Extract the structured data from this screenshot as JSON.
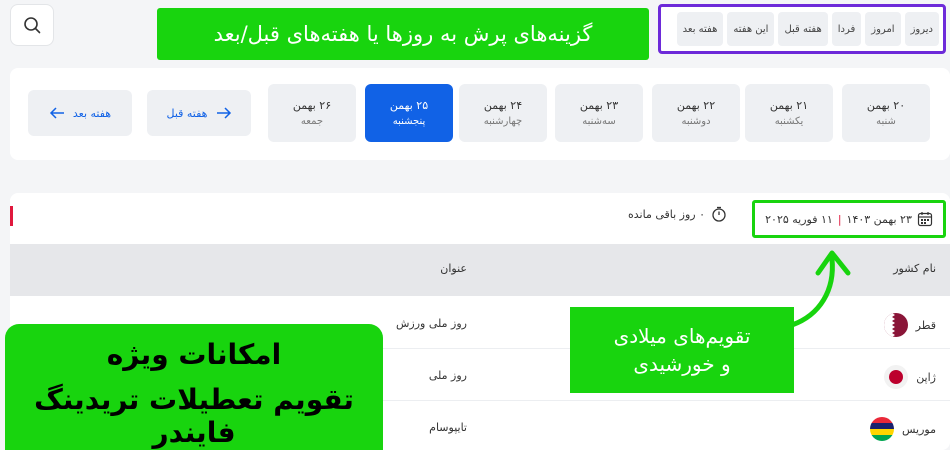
{
  "quick_nav": [
    "دیروز",
    "امروز",
    "فردا",
    "هفته قبل",
    "این هفته",
    "هفته بعد"
  ],
  "callouts": {
    "top": "گزینه‌های پرش به روزها یا هفته‌های قبل/بعد",
    "mid_line1": "تقویم‌های میلادی",
    "mid_line2": "و خورشیدی",
    "bottom_line1": "امکانات  ویژه",
    "bottom_line2": "تقویم تعطیلات تریدینگ فایندر"
  },
  "week": {
    "days": [
      {
        "date": "۲۰ بهمن",
        "weekday": "شنبه",
        "active": false
      },
      {
        "date": "۲۱ بهمن",
        "weekday": "یکشنبه",
        "active": false
      },
      {
        "date": "۲۲ بهمن",
        "weekday": "دوشنبه",
        "active": false
      },
      {
        "date": "۲۳ بهمن",
        "weekday": "سه‌شنبه",
        "active": false
      },
      {
        "date": "۲۴ بهمن",
        "weekday": "چهارشنبه",
        "active": false
      },
      {
        "date": "۲۵ بهمن",
        "weekday": "پنجشنبه",
        "active": true
      },
      {
        "date": "۲۶ بهمن",
        "weekday": "جمعه",
        "active": false
      }
    ],
    "prev_label": "هفته قبل",
    "next_label": "هفته بعد"
  },
  "selected_date": {
    "jalali": "۲۳ بهمن ۱۴۰۳",
    "separator": "|",
    "gregorian": "۱۱ فوریه ۲۰۲۵"
  },
  "remaining": "۰ روز باقی مانده",
  "table": {
    "headers": {
      "country": "نام کشور",
      "title": "عنوان"
    },
    "rows": [
      {
        "country": "قطر",
        "title": "روز ملی ورزش"
      },
      {
        "country": "ژاپن",
        "title": "روز ملی"
      },
      {
        "country": "موریس",
        "title": "تایپوسام"
      }
    ]
  },
  "colors": {
    "accent": "#1162e6",
    "callout": "#18d40e",
    "frame": "#6d2ad9"
  }
}
